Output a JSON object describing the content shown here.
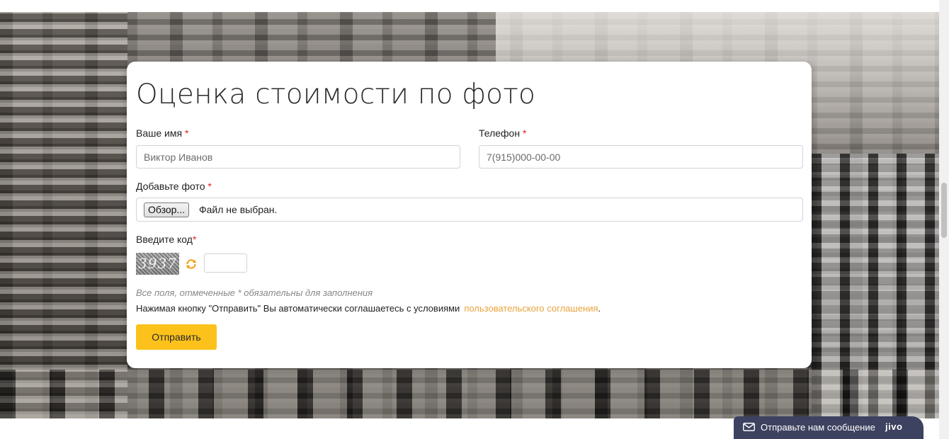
{
  "form": {
    "title": "Оценка стоимости по фото",
    "name_label": "Ваше имя",
    "name_placeholder": "Виктор Иванов",
    "phone_label": "Телефон",
    "phone_placeholder": "7(915)000-00-00",
    "photo_label": "Добавьте фото",
    "file_button_label": "Обзор...",
    "file_status": "Файл не выбран.",
    "captcha_label": "Введите код",
    "captcha_code": "3937",
    "required_marker": "*",
    "required_note": "Все поля, отмеченные * обязательны для заполнения",
    "agreement_text": "Нажимая кнопку \"Отправить\" Вы автоматически соглашаетесь с условиями",
    "agreement_link": "пользовательского соглашения",
    "agreement_end": ".",
    "submit_label": "Отправить"
  },
  "chat_widget": {
    "label": "Отправьте нам сообщение",
    "brand": "jivo"
  },
  "colors": {
    "accent": "#fcc21b",
    "link": "#e8a33b",
    "required": "#e02020",
    "chat_bg": "#3d4260"
  },
  "icons": [
    "refresh-icon",
    "mail-icon"
  ]
}
